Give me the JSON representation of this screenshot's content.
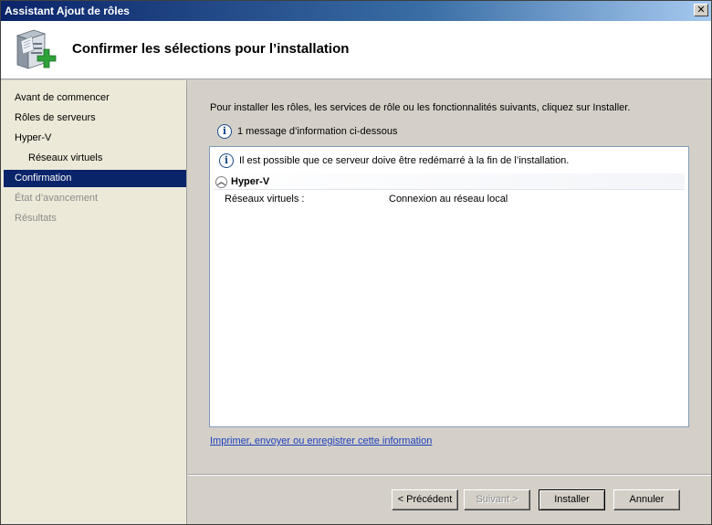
{
  "window": {
    "title": "Assistant Ajout de rôles",
    "close_glyph": "✕"
  },
  "header": {
    "title": "Confirmer les sélections pour l’installation",
    "icon": "server-add-icon"
  },
  "sidebar": {
    "items": [
      {
        "label": "Avant de commencer",
        "state": "normal"
      },
      {
        "label": "Rôles de serveurs",
        "state": "normal"
      },
      {
        "label": "Hyper-V",
        "state": "normal"
      },
      {
        "label": "Réseaux virtuels",
        "state": "sub"
      },
      {
        "label": "Confirmation",
        "state": "active"
      },
      {
        "label": "État d’avancement",
        "state": "disabled"
      },
      {
        "label": "Résultats",
        "state": "disabled"
      }
    ]
  },
  "main": {
    "intro": "Pour installer les rôles, les services de rôle ou les fonctionnalités suivants, cliquez sur Installer.",
    "info_count": "1 message d’information ci-dessous",
    "panel": {
      "info_message": "Il est possible que ce serveur doive être redémarré à la fin de l’installation.",
      "section_title": "Hyper-V",
      "rows": [
        {
          "label": "Réseaux virtuels :",
          "value": "Connexion au réseau local"
        }
      ]
    },
    "link": "Imprimer, envoyer ou enregistrer cette information"
  },
  "buttons": {
    "previous": "< Précédent",
    "next": "Suivant >",
    "install": "Installer",
    "cancel": "Annuler"
  },
  "colors": {
    "active_nav": "#0a246a",
    "link": "#1b3fbf",
    "dialog_bg": "#d4d0c8"
  }
}
